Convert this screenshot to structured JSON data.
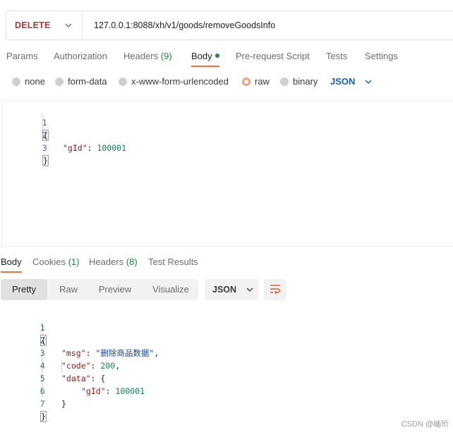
{
  "request": {
    "method": "DELETE",
    "url": "127.0.0.1:8088/xh/v1/goods/removeGoodsInfo"
  },
  "request_tabs": [
    {
      "label": "Params"
    },
    {
      "label": "Authorization"
    },
    {
      "label": "Headers",
      "count": "(9)"
    },
    {
      "label": "Body",
      "has_dot": true
    },
    {
      "label": "Pre-request Script"
    },
    {
      "label": "Tests"
    },
    {
      "label": "Settings"
    }
  ],
  "body_types": [
    {
      "label": "none",
      "checked": false
    },
    {
      "label": "form-data",
      "checked": false
    },
    {
      "label": "x-www-form-urlencoded",
      "checked": false
    },
    {
      "label": "raw",
      "checked": true
    },
    {
      "label": "binary",
      "checked": false
    }
  ],
  "body_format": "JSON",
  "request_body_lines": [
    {
      "n": "1",
      "text": "{"
    },
    {
      "n": "2",
      "key": "\"gId\"",
      "sep": ": ",
      "value": "100001"
    },
    {
      "n": "3",
      "text": "}"
    }
  ],
  "response_tabs": [
    {
      "label": "Body"
    },
    {
      "label": "Cookies",
      "count": "(1)"
    },
    {
      "label": "Headers",
      "count": "(8)"
    },
    {
      "label": "Test Results"
    }
  ],
  "response_views": [
    "Pretty",
    "Raw",
    "Preview",
    "Visualize"
  ],
  "response_format": "JSON",
  "response_body_lines": [
    {
      "n": "1",
      "text": "{"
    },
    {
      "n": "2",
      "key": "\"msg\"",
      "sep": ": ",
      "value": "\"删除商品数据\"",
      "tail": ","
    },
    {
      "n": "3",
      "key": "\"code\"",
      "sep": ": ",
      "value": "200",
      "tail": ","
    },
    {
      "n": "4",
      "key": "\"data\"",
      "sep": ": ",
      "value": "{"
    },
    {
      "n": "5",
      "key": "\"gId\"",
      "sep": ": ",
      "value": "100001"
    },
    {
      "n": "6",
      "text": "}"
    },
    {
      "n": "7",
      "text": "}"
    }
  ],
  "watermark": "CSDN @岫珩",
  "icons": {
    "method_dropdown": "chevron-down-icon",
    "format_dropdown": "chevron-down-icon",
    "wrap": "wrap-lines-icon"
  },
  "colors": {
    "accent": "#ff6c37",
    "method": "#b03a2e",
    "link": "#0b5ed7",
    "count_green": "#1e8a3c"
  }
}
